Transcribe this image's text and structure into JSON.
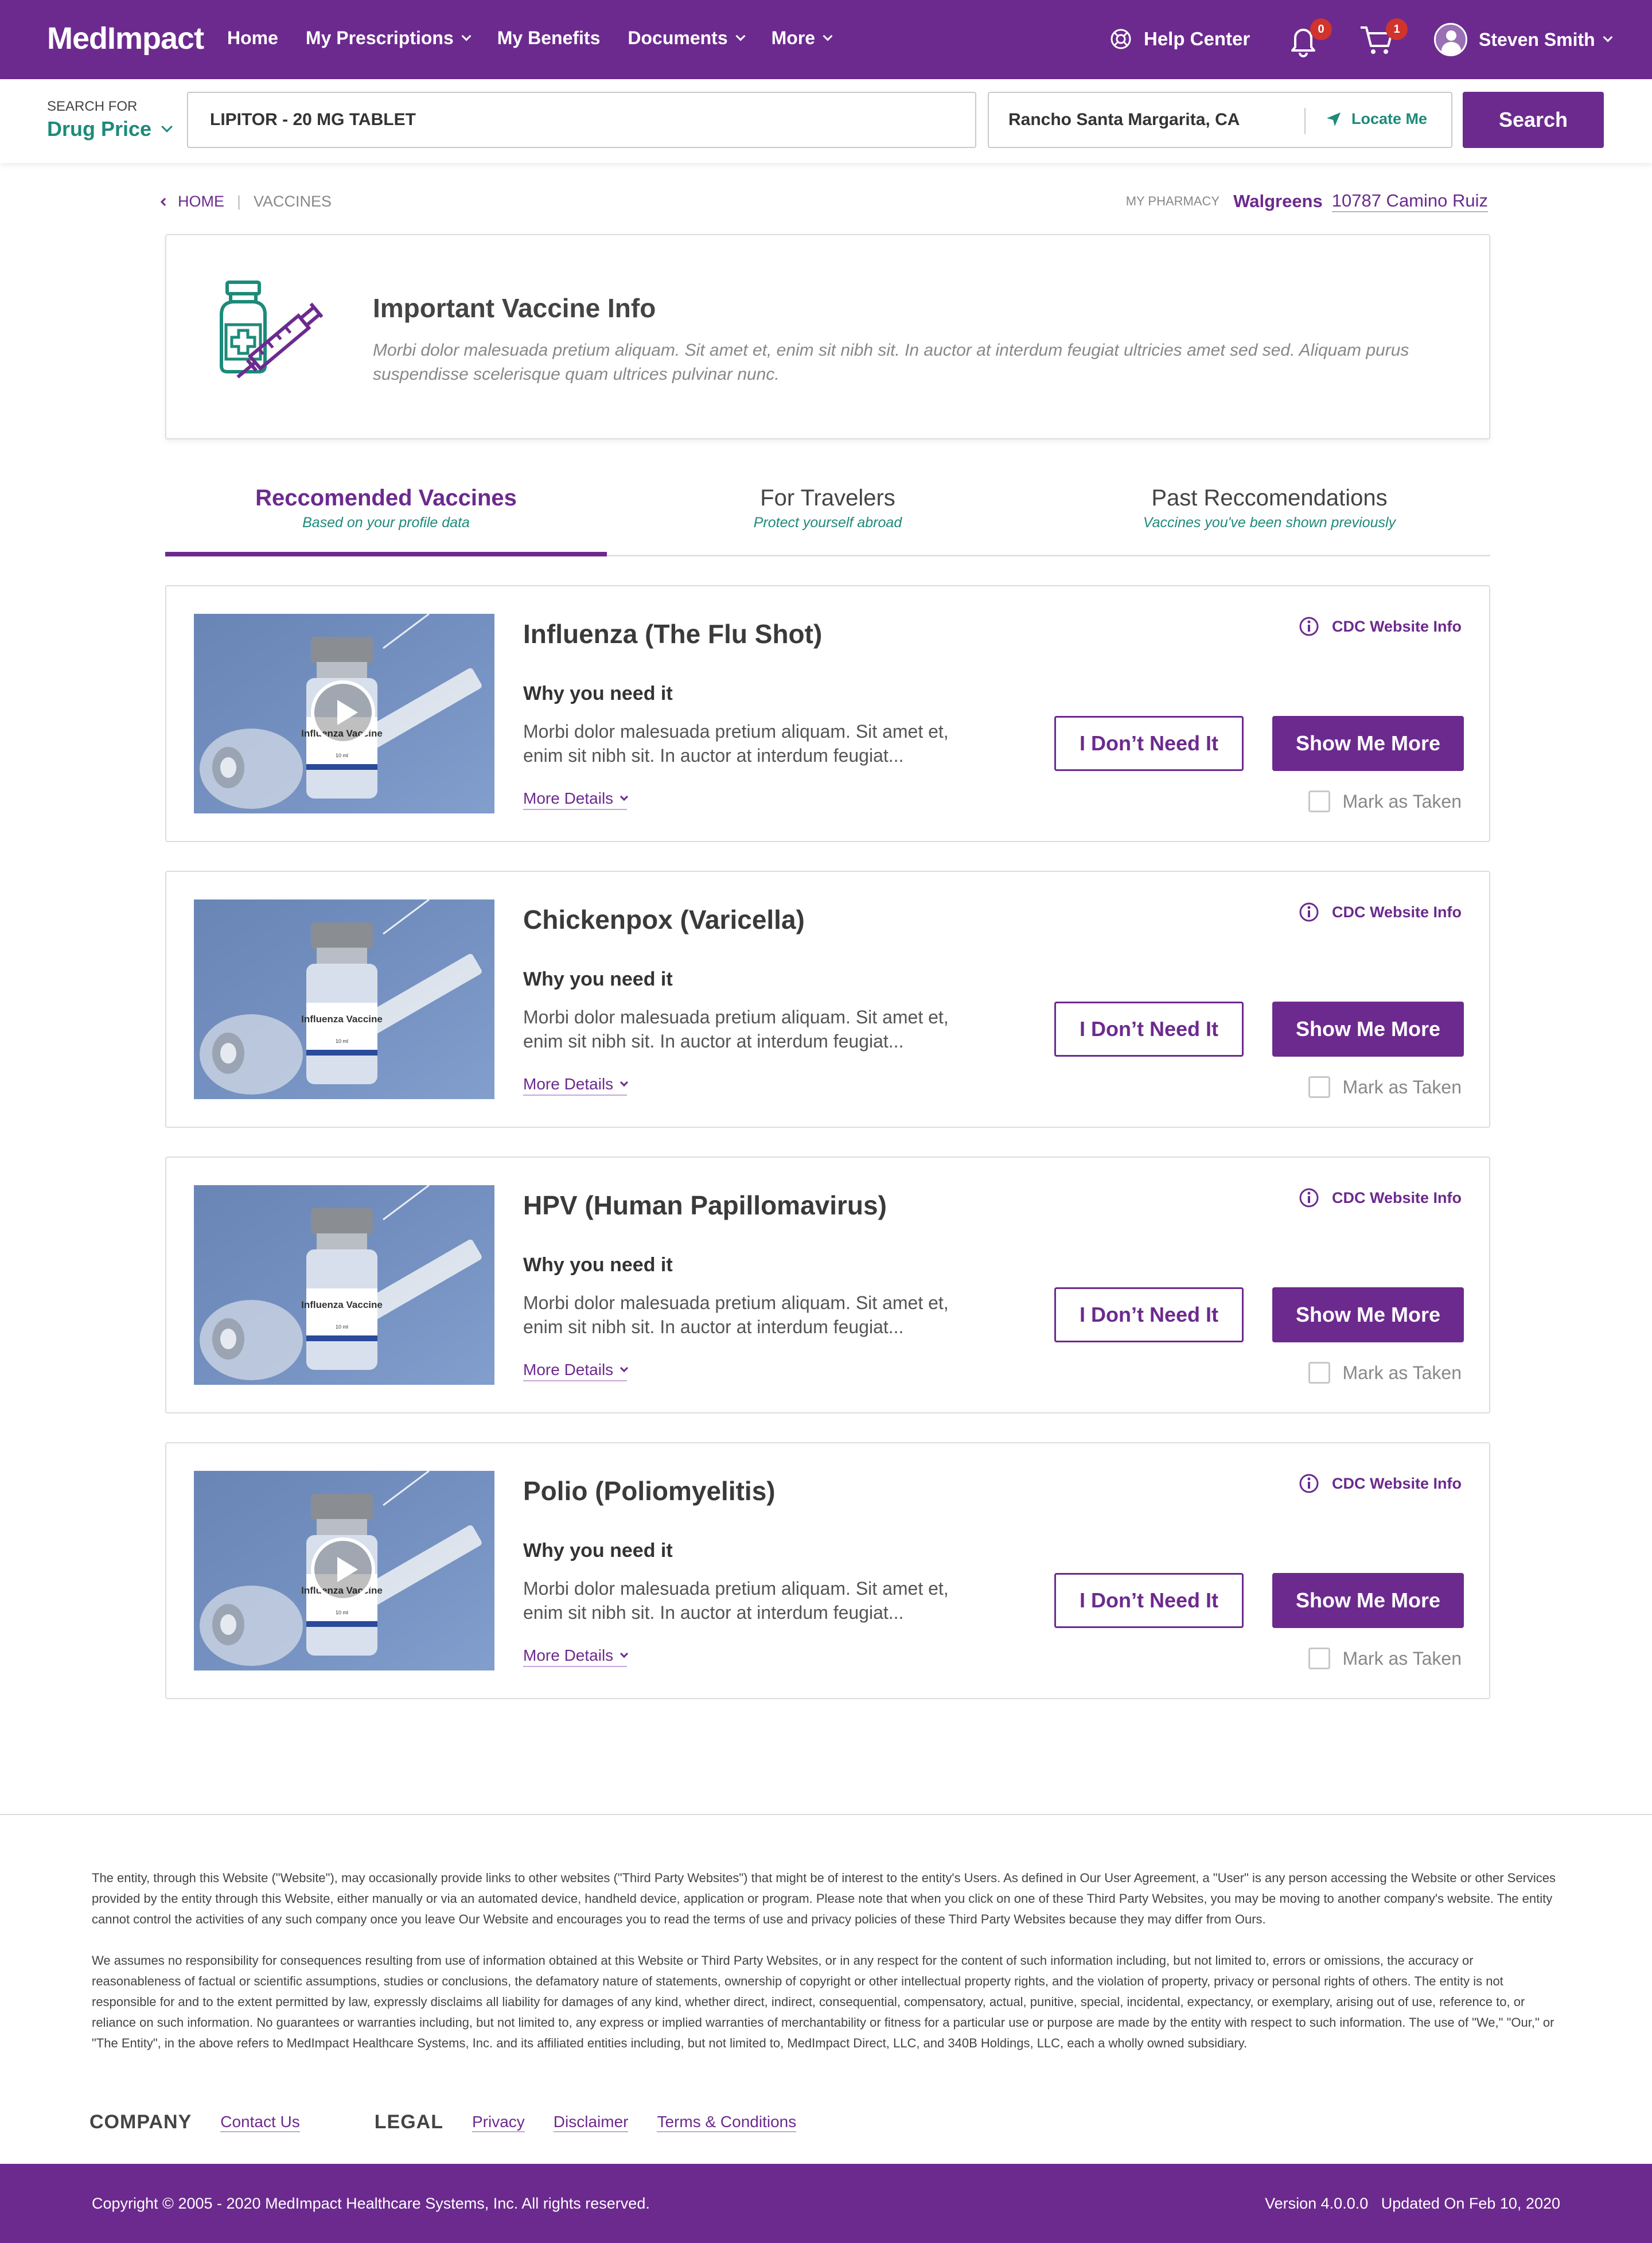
{
  "header": {
    "logo": "MedImpact",
    "nav": [
      "Home",
      "My Prescriptions",
      "My Benefits",
      "Documents",
      "More"
    ],
    "help": "Help Center",
    "notifications_count": "0",
    "cart_count": "1",
    "user_name": "Steven Smith"
  },
  "search": {
    "label": "SEARCH FOR",
    "type": "Drug Price",
    "drug": "LIPITOR - 20 MG TABLET",
    "location": "Rancho Santa Margarita, CA",
    "locate": "Locate Me",
    "button": "Search"
  },
  "breadcrumb": {
    "home": "HOME",
    "current": "VACCINES"
  },
  "pharmacy": {
    "label": "MY PHARMACY",
    "name": "Walgreens",
    "address": "10787 Camino Ruiz"
  },
  "info": {
    "title": "Important Vaccine Info",
    "text": "Morbi dolor malesuada pretium aliquam. Sit amet et, enim sit nibh sit. In auctor at interdum feugiat ultricies amet sed sed. Aliquam purus suspendisse scelerisque quam ultrices pulvinar nunc."
  },
  "tabs": [
    {
      "label": "Reccomended Vaccines",
      "sub": "Based on your profile data"
    },
    {
      "label": "For Travelers",
      "sub": "Protect yourself abroad"
    },
    {
      "label": "Past Reccomendations",
      "sub": "Vaccines you've been shown previously"
    }
  ],
  "vaccines": [
    {
      "name": "Influenza (The Flu Shot)",
      "why": "Why you need it",
      "desc": "Morbi dolor malesuada pretium aliquam. Sit amet et, enim sit nibh sit. In auctor at interdum feugiat...",
      "more": "More Details",
      "cdc": "CDC Website Info",
      "no": "I Don’t Need It",
      "show": "Show Me More",
      "taken": "Mark as Taken",
      "vial_label": "Influenza Vaccine"
    },
    {
      "name": "Chickenpox (Varicella)",
      "why": "Why you need it",
      "desc": "Morbi dolor malesuada pretium aliquam. Sit amet et, enim sit nibh sit. In auctor at interdum feugiat...",
      "more": "More Details",
      "cdc": "CDC Website Info",
      "no": "I Don’t Need It",
      "show": "Show Me More",
      "taken": "Mark as Taken",
      "vial_label": "Influenza Vaccine"
    },
    {
      "name": "HPV (Human Papillomavirus)",
      "why": "Why you need it",
      "desc": "Morbi dolor malesuada pretium aliquam. Sit amet et, enim sit nibh sit. In auctor at interdum feugiat...",
      "more": "More Details",
      "cdc": "CDC Website Info",
      "no": "I Don’t Need It",
      "show": "Show Me More",
      "taken": "Mark as Taken",
      "vial_label": "Influenza Vaccine"
    },
    {
      "name": "Polio (Poliomyelitis)",
      "why": "Why you need it",
      "desc": "Morbi dolor malesuada pretium aliquam. Sit amet et, enim sit nibh sit. In auctor at interdum feugiat...",
      "more": "More Details",
      "cdc": "CDC Website Info",
      "no": "I Don’t Need It",
      "show": "Show Me More",
      "taken": "Mark as Taken",
      "vial_label": "Influenza Vaccine"
    }
  ],
  "footer": {
    "disclaimer1": "The entity, through this Website (\"Website\"), may occasionally provide links to other websites (\"Third Party Websites\") that might be of interest to the entity's Users. As defined in Our User Agreement, a \"User\" is any person accessing the Website or other Services provided by the entity through this Website, either manually or via an automated device, handheld device, application or program. Please note that when you click on one of these Third Party Websites, you may be moving to another company's website. The entity cannot control the activities of any such company once you leave Our Website and encourages you to read the terms of use and privacy policies of these Third Party Websites because they may differ from Ours.",
    "disclaimer2": "We assumes no responsibility for consequences resulting from use of information obtained at this Website or Third Party Websites, or in any respect for the content of such information including, but not limited to, errors or omissions, the accuracy or reasonableness of factual or scientific assumptions, studies or conclusions, the defamatory nature of statements, ownership of copyright or other intellectual property rights, and the violation of property, privacy or personal rights of others. The entity is not responsible for and to the extent permitted by law, expressly disclaims all liability for damages of any kind, whether direct, indirect, consequential, compensatory, actual, punitive, special, incidental, expectancy, or exemplary, arising out of use, reference to, or reliance on such information. No guarantees or warranties including, but not limited to, any express or implied warranties of merchantability or fitness for a particular use or purpose are made by the entity with respect to such information. The use of \"We,\" \"Our,\" or \"The Entity\", in the above refers to MedImpact Healthcare Systems, Inc. and its affiliated entities including, but not limited to, MedImpact Direct, LLC, and 340B Holdings, LLC, each a wholly owned subsidiary.",
    "company_heading": "COMPANY",
    "contact": "Contact Us",
    "legal_heading": "LEGAL",
    "privacy": "Privacy",
    "disclaimer_link": "Disclaimer",
    "terms": "Terms & Conditions",
    "copyright": "Copyright © 2005 - 2020 MedImpact Healthcare Systems, Inc. All rights reserved.",
    "version": "Version 4.0.0.0",
    "updated": "Updated On Feb 10, 2020"
  },
  "colors": {
    "brand": "#6c2a8e",
    "accent": "#1d8a7a",
    "badge": "#d0342c"
  }
}
